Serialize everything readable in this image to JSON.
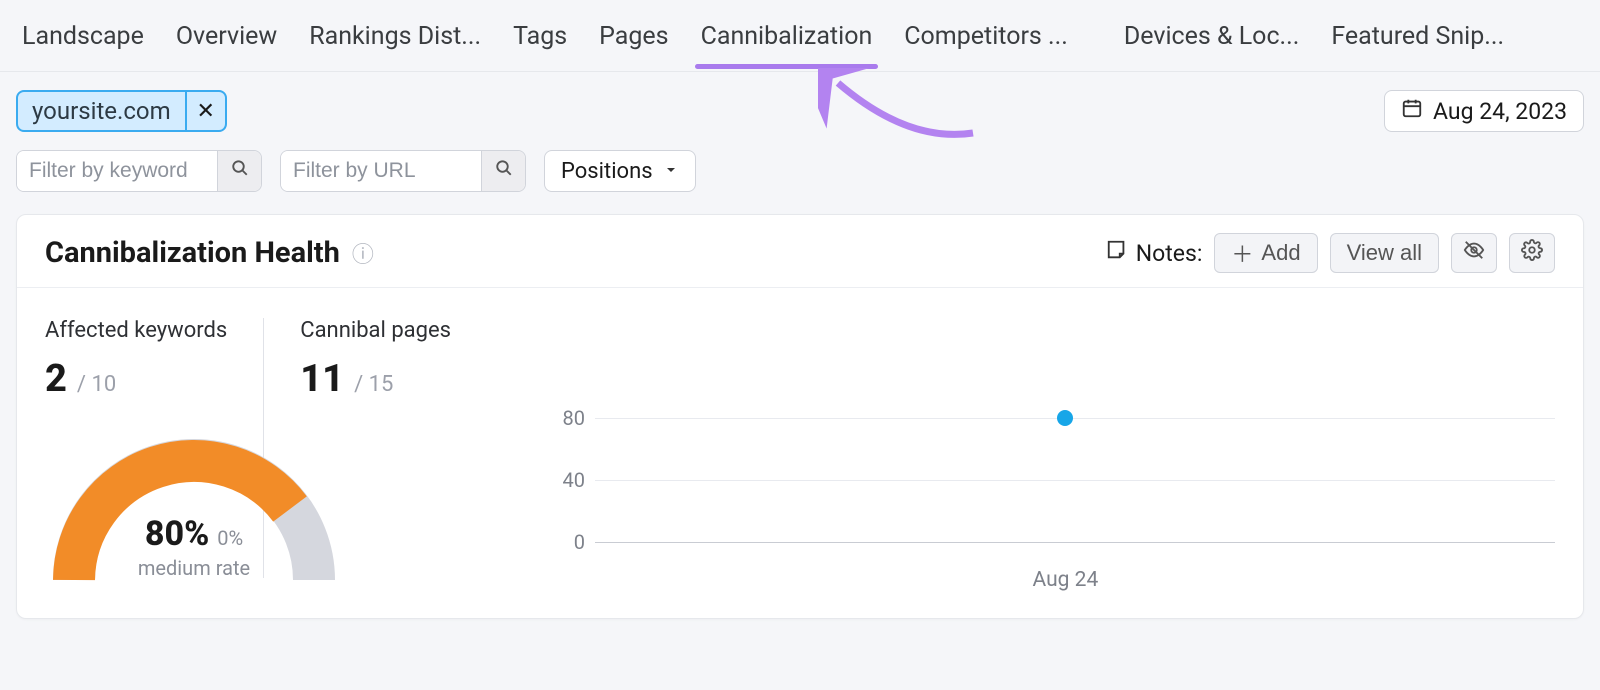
{
  "nav": {
    "tabs": [
      {
        "label": "Landscape"
      },
      {
        "label": "Overview"
      },
      {
        "label": "Rankings Dist..."
      },
      {
        "label": "Tags"
      },
      {
        "label": "Pages"
      },
      {
        "label": "Cannibalization",
        "active": true
      },
      {
        "label": "Competitors ..."
      },
      {
        "label": "Devices & Loc..."
      },
      {
        "label": "Featured Snip..."
      }
    ]
  },
  "filters": {
    "site_chip": "yoursite.com",
    "keyword_placeholder": "Filter by keyword",
    "url_placeholder": "Filter by URL",
    "positions_label": "Positions",
    "date_label": "Aug 24, 2023"
  },
  "card": {
    "title": "Cannibalization Health",
    "notes_label": "Notes:",
    "add_label": "Add",
    "viewall_label": "View all"
  },
  "stats": {
    "affected_label": "Affected keywords",
    "affected_value": "2",
    "affected_total": "/ 10",
    "cannibal_label": "Cannibal pages",
    "cannibal_value": "11",
    "cannibal_total": "/ 15"
  },
  "gauge": {
    "percent": "80%",
    "delta": "0%",
    "sub": "medium rate"
  },
  "chart": {
    "y0": "0",
    "y1": "40",
    "y2": "80",
    "x0": "Aug 24"
  },
  "chart_data": {
    "type": "line",
    "x": [
      "Aug 24"
    ],
    "values": [
      80
    ],
    "ylim": [
      0,
      80
    ],
    "yticks": [
      0,
      40,
      80
    ],
    "xlabel": "",
    "ylabel": "",
    "title": ""
  }
}
